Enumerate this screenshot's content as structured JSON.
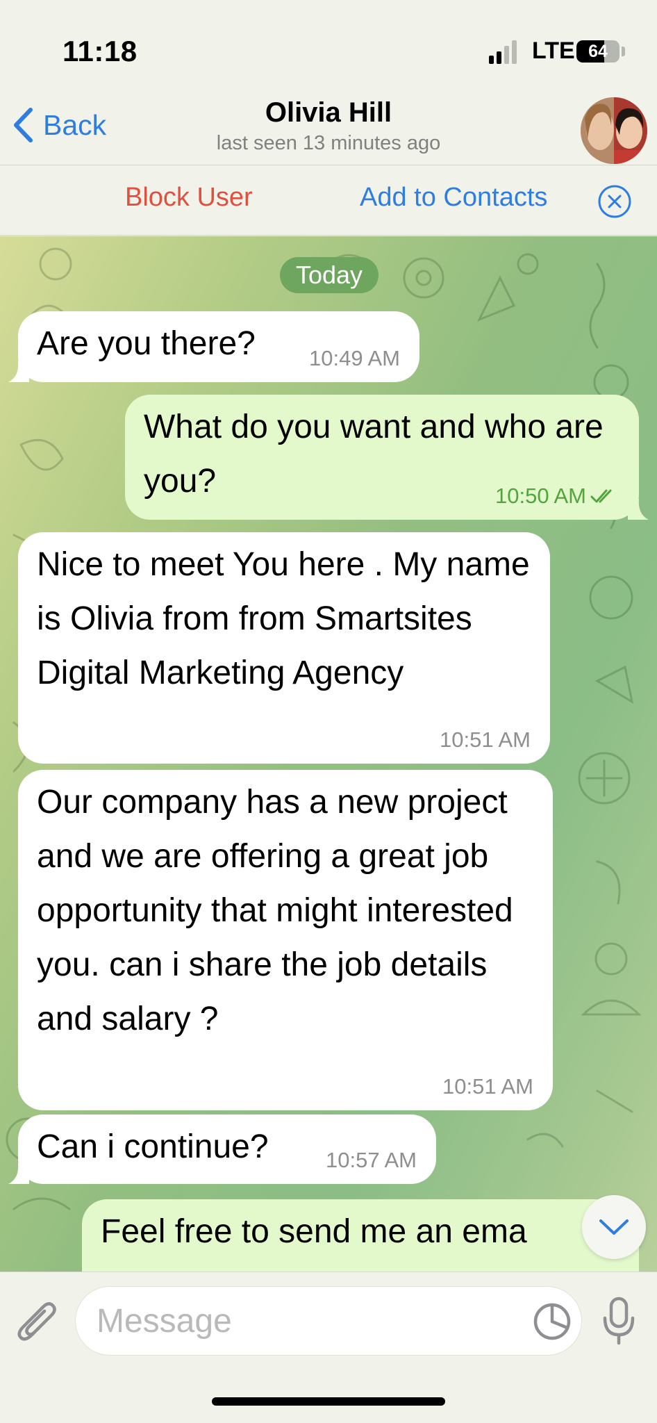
{
  "status_bar": {
    "time": "11:18",
    "network": "LTE",
    "battery": "64",
    "battery_level": 0.64
  },
  "header": {
    "back_label": "Back",
    "contact_name": "Olivia Hill",
    "last_seen": "last seen 13 minutes ago"
  },
  "action_bar": {
    "block_label": "Block User",
    "add_contact_label": "Add to Contacts"
  },
  "chat": {
    "date_separator": "Today",
    "messages": [
      {
        "direction": "incoming",
        "text": "Are you there?",
        "time": "10:49 AM"
      },
      {
        "direction": "outgoing",
        "text": "What do you want and who are you?",
        "time": "10:50 AM",
        "read": true
      },
      {
        "direction": "incoming",
        "text": "Nice to meet You here . My name is Olivia  from  from Smartsites Digital Marketing Agency",
        "time": "10:51 AM"
      },
      {
        "direction": "incoming",
        "text": "Our company has a new project and we are offering a great job opportunity that might interested you. can i share the job details and salary ?",
        "time": "10:51 AM"
      },
      {
        "direction": "incoming",
        "text": "Can i continue?",
        "time": "10:57 AM"
      },
      {
        "direction": "outgoing",
        "text": "Feel free to send me an ema",
        "time": ""
      }
    ]
  },
  "composer": {
    "placeholder": "Message"
  },
  "colors": {
    "accent": "#2f7de1",
    "danger": "#e0503f",
    "outgoing_bubble": "#e3f9cc",
    "incoming_bubble": "#ffffff",
    "date_pill": "#6ea660",
    "read_check": "#52a43c"
  },
  "icons": {
    "back": "chevron-left-icon",
    "close": "close-circle-icon",
    "attach": "paperclip-icon",
    "sticker": "sticker-icon",
    "mic": "microphone-icon",
    "scroll_down": "chevron-down-icon",
    "read": "double-check-icon"
  }
}
